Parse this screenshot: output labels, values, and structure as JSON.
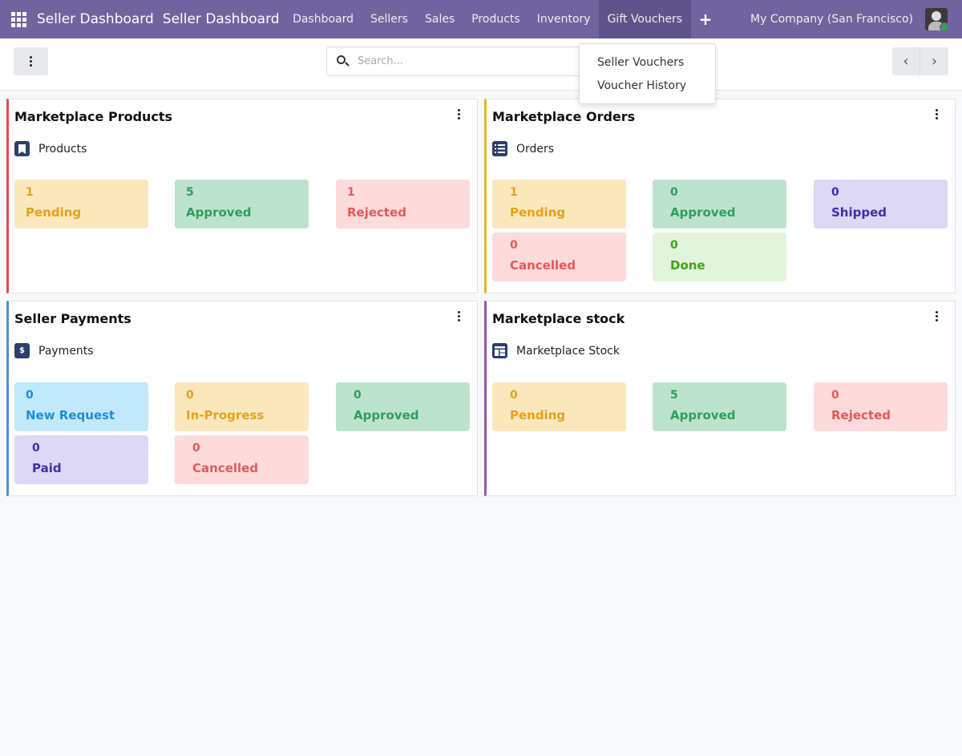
{
  "navbar": {
    "brand": "Seller Dashboard",
    "brand_secondary": "Seller Dashboard",
    "menu": [
      "Dashboard",
      "Sellers",
      "Sales",
      "Products",
      "Inventory",
      "Gift Vouchers"
    ],
    "company": "My Company (San Francisco)",
    "color": "#71639e"
  },
  "control": {
    "search_placeholder": "Search..."
  },
  "dropdown": {
    "items": [
      "Seller Vouchers",
      "Voucher History"
    ]
  },
  "cards": {
    "products": {
      "title": "Marketplace Products",
      "sub_label": "Products",
      "accent": "#e04b4b",
      "tiles": [
        {
          "value": "1",
          "label": "Pending"
        },
        {
          "value": "5",
          "label": "Approved"
        },
        {
          "value": "1",
          "label": "Rejected"
        }
      ]
    },
    "orders": {
      "title": "Marketplace Orders",
      "sub_label": "Orders",
      "accent": "#e8b822",
      "tiles": [
        {
          "value": "1",
          "label": "Pending"
        },
        {
          "value": "0",
          "label": "Approved"
        },
        {
          "value": "0",
          "label": "Shipped"
        },
        {
          "value": "0",
          "label": "Cancelled"
        },
        {
          "value": "0",
          "label": "Done"
        }
      ]
    },
    "payments": {
      "title": "Seller Payments",
      "sub_label": "Payments",
      "accent": "#4a90d9",
      "tiles": [
        {
          "value": "0",
          "label": "New Request"
        },
        {
          "value": "0",
          "label": "In-Progress"
        },
        {
          "value": "0",
          "label": "Approved"
        },
        {
          "value": "0",
          "label": "Paid"
        },
        {
          "value": "0",
          "label": "Cancelled"
        }
      ]
    },
    "stock": {
      "title": "Marketplace stock",
      "sub_label": "Marketplace Stock",
      "accent": "#9b59a8",
      "tiles": [
        {
          "value": "0",
          "label": "Pending"
        },
        {
          "value": "5",
          "label": "Approved"
        },
        {
          "value": "0",
          "label": "Rejected"
        }
      ]
    }
  }
}
